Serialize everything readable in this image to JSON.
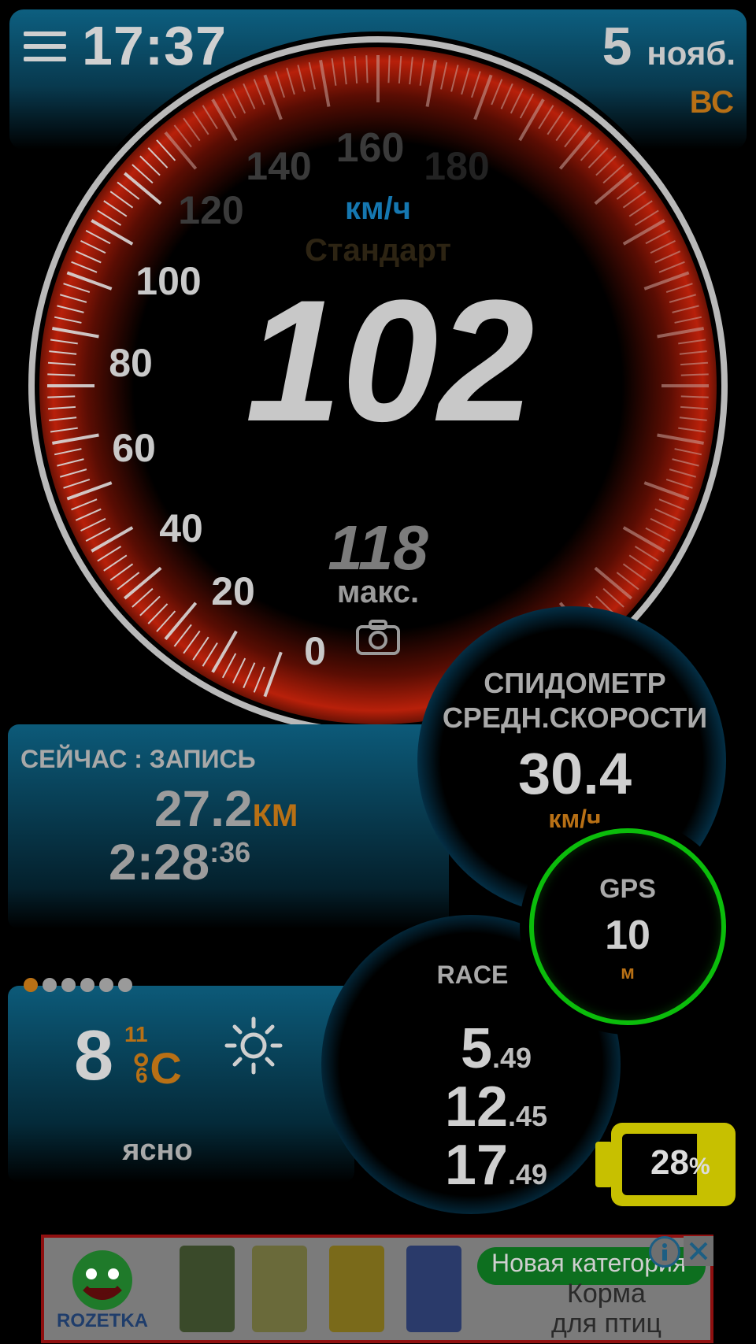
{
  "header": {
    "time": "17:37",
    "date_day": "5",
    "date_month": "нояб.",
    "weekday": "ВС"
  },
  "speedometer": {
    "current_speed": "102",
    "unit": "км/ч",
    "mode": "Стандарт",
    "max_value": "118",
    "max_label": "макс.",
    "scale_labels": [
      "0",
      "20",
      "40",
      "60",
      "80",
      "100",
      "120",
      "140",
      "160",
      "180"
    ]
  },
  "record": {
    "title": "СЕЙЧАС : ЗАПИСЬ",
    "distance": "27.2",
    "distance_unit": "КМ",
    "time_main": "2:28",
    "time_seconds": ":36"
  },
  "average": {
    "title_line1": "СПИДОМЕТР",
    "title_line2": "СРЕДН.СКОРОСТИ",
    "value": "30.4",
    "unit": "км/ч"
  },
  "gps": {
    "label": "GPS",
    "accuracy": "10",
    "unit": "м"
  },
  "weather": {
    "temperature": "8",
    "temp_max": "11",
    "temp_min": "6",
    "unit": "°C",
    "condition": "ясно",
    "page_dots": 6,
    "active_dot": 0,
    "icon": "sun-icon"
  },
  "race": {
    "title": "RACE",
    "rows": [
      {
        "main": "5",
        "decimal": ".49"
      },
      {
        "main": "12",
        "decimal": ".45"
      },
      {
        "main": "17",
        "decimal": ".49"
      }
    ]
  },
  "battery": {
    "percent": "28",
    "percent_sign": "%",
    "level": 0.28,
    "color": "#c7c000"
  },
  "ad": {
    "brand": "ROZETKA",
    "bubble_text": "Новая категория",
    "line1": "Корма",
    "line2": "для птиц",
    "info_icon": "info-icon",
    "close_icon": "close-icon"
  },
  "colors": {
    "accent_orange": "#b87015",
    "accent_blue": "#0c6a97",
    "gps_green": "#0bbd0b",
    "gauge_red": "#b8200a"
  }
}
